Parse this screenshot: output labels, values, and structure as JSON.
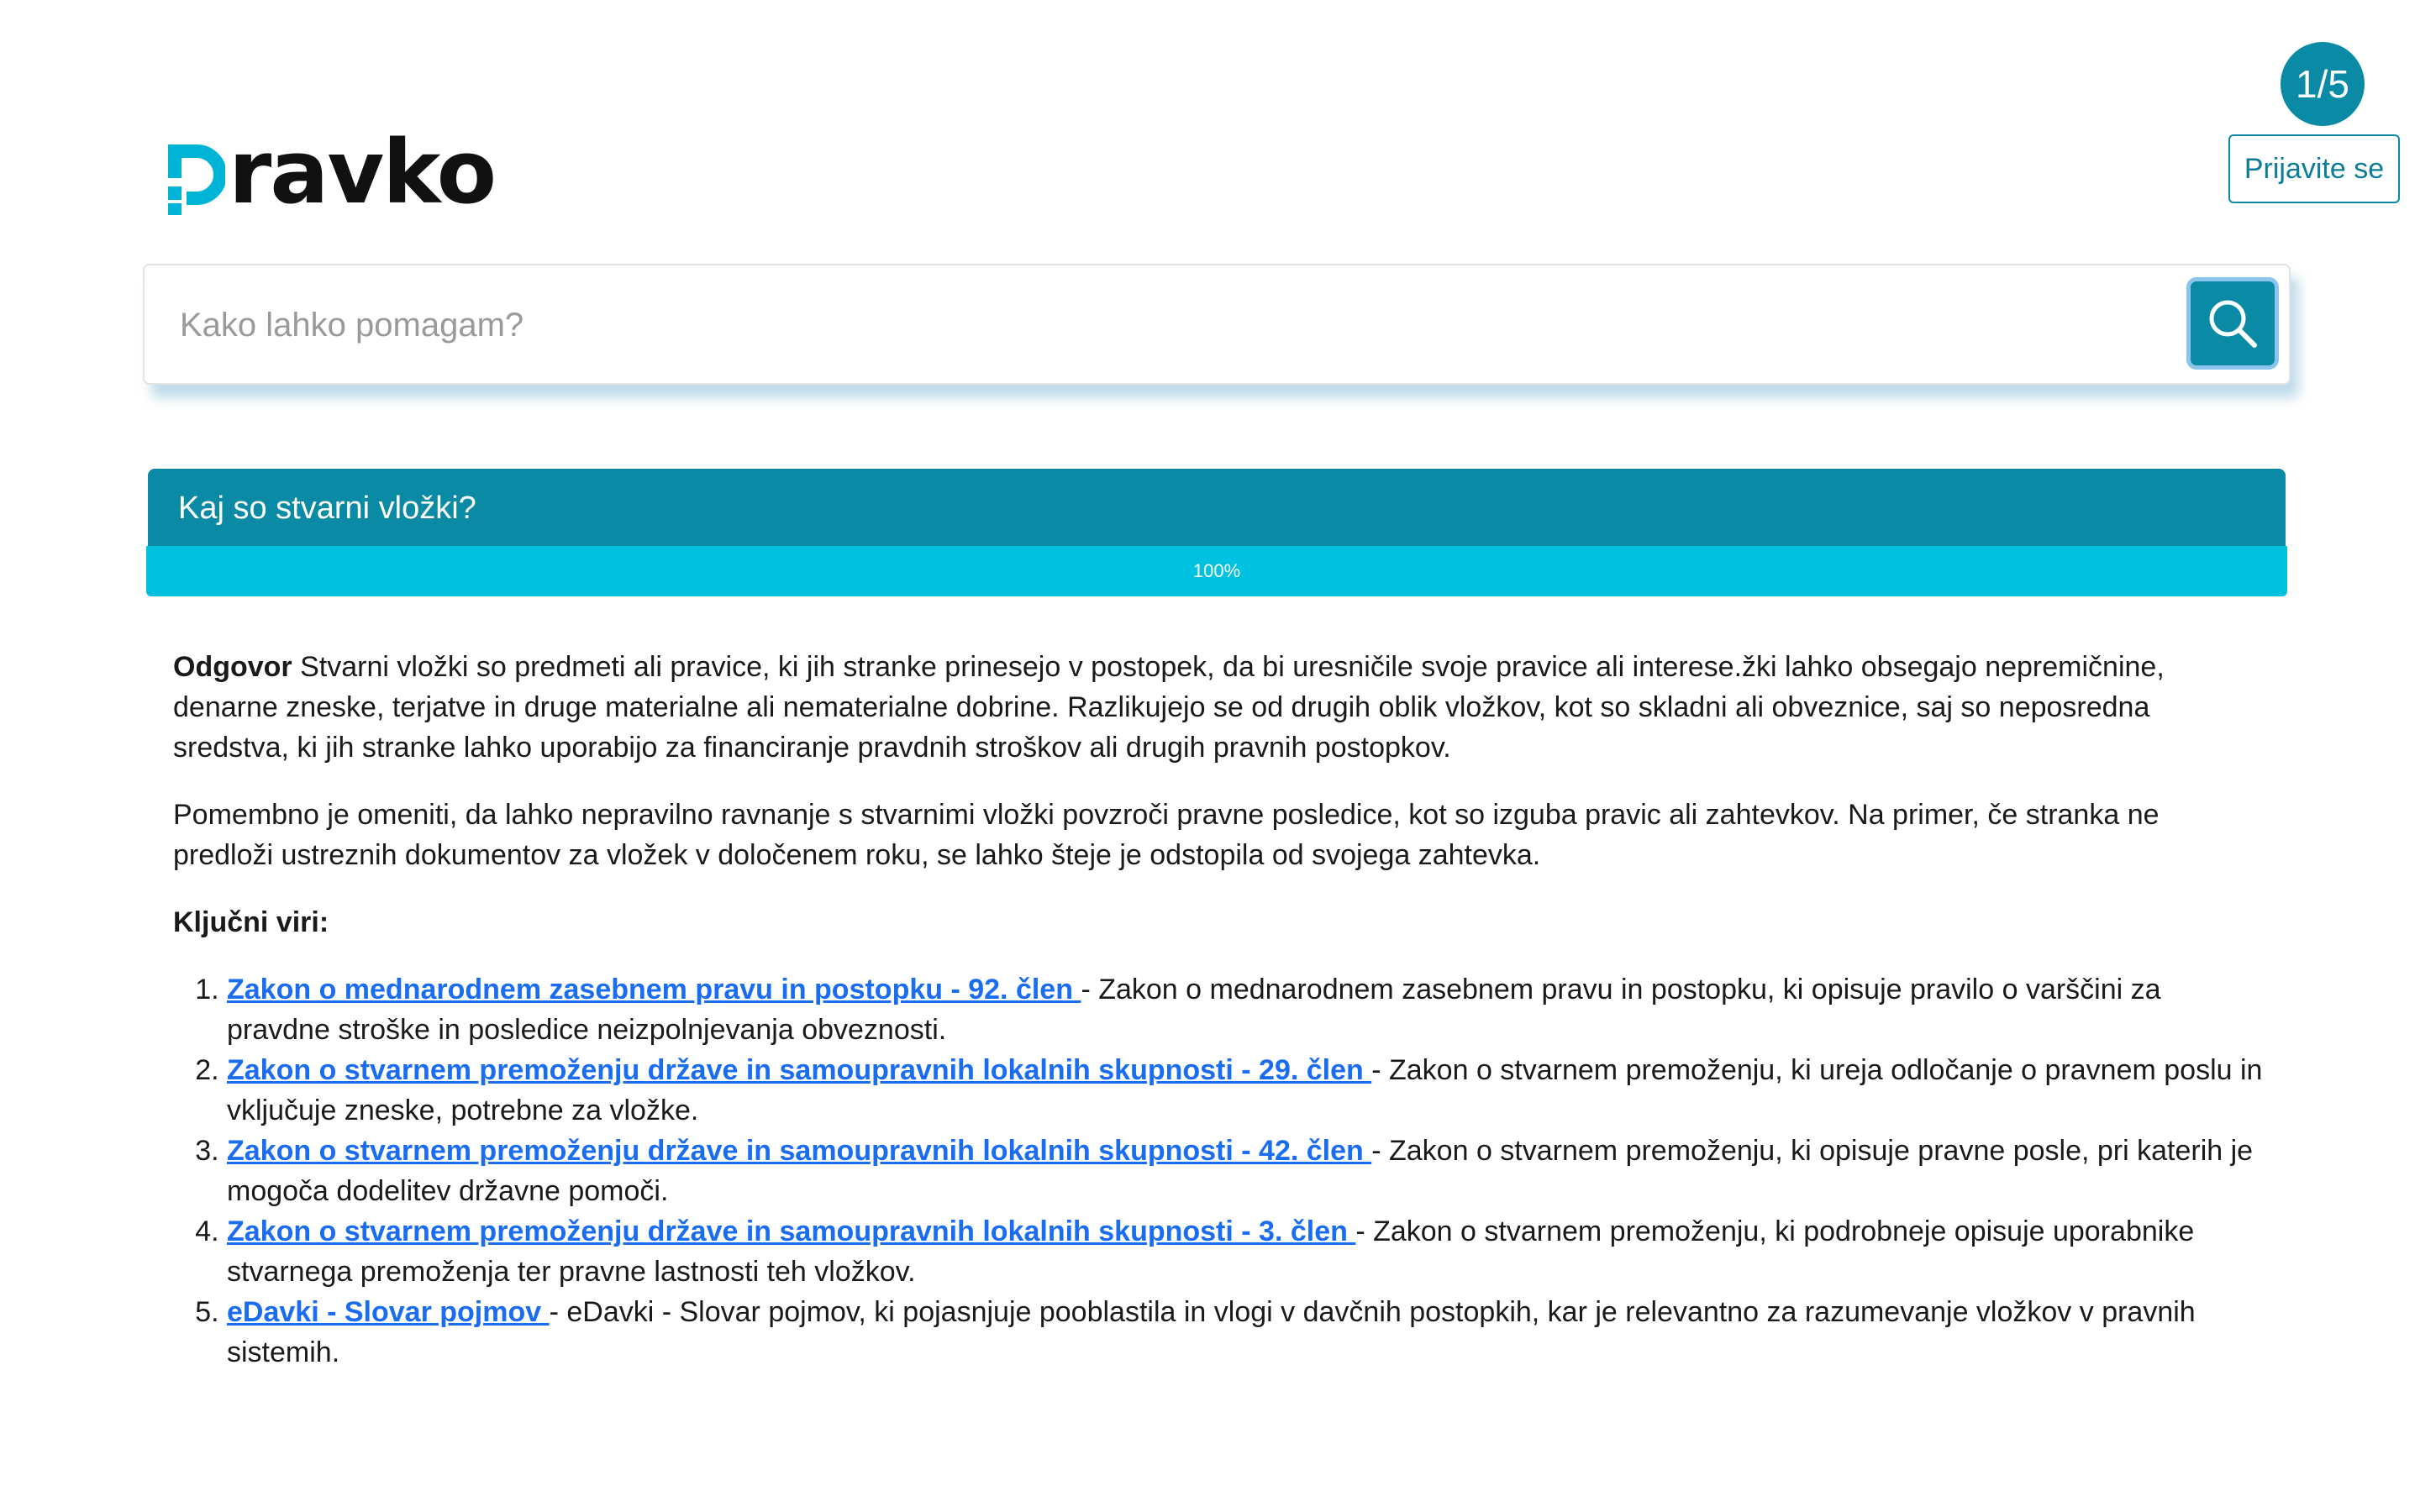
{
  "header": {
    "counter": "1/5",
    "login_label": "Prijavite se",
    "logo_text": "ravko",
    "logo_full": "pravko"
  },
  "search": {
    "placeholder": "Kako lahko pomagam?"
  },
  "question": {
    "title": "Kaj so stvarni vložki?",
    "progress_label": "100%",
    "progress_value": 1.0
  },
  "answer": {
    "lead": "Odgovor",
    "paragraph1": " Stvarni vložki so predmeti ali pravice, ki jih stranke prinesejo v postopek, da bi uresničile svoje pravice ali interese.žki lahko obsegajo nepremičnine, denarne zneske, terjatve in druge materialne ali nematerialne dobrine. Razlikujejo se od drugih oblik vložkov, kot so skladni ali obveznice, saj so neposredna sredstva, ki jih stranke lahko uporabijo za financiranje pravdnih stroškov ali drugih pravnih postopkov.",
    "paragraph2": "Pomembno je omeniti, da lahko nepravilno ravnanje s stvarnimi vložki povzroči pravne posledice, kot so izguba pravic ali zahtevkov. Na primer, če stranka ne predloži ustreznih dokumentov za vložek v določenem roku, se lahko šteje je odstopila od svojega zahtevka.",
    "sources_title": "Ključni viri:",
    "sources": [
      {
        "link": "Zakon o mednarodnem zasebnem pravu in postopku - 92. člen ",
        "desc": " - Zakon o mednarodnem zasebnem pravu in postopku, ki opisuje pravilo o varščini za pravdne stroške in posledice neizpolnjevanja obveznosti."
      },
      {
        "link": "Zakon o stvarnem premoženju države in samoupravnih lokalnih skupnosti - 29. člen ",
        "desc": " - Zakon o stvarnem premoženju, ki ureja odločanje o pravnem poslu in vključuje zneske, potrebne za vložke."
      },
      {
        "link": "Zakon o stvarnem premoženju države in samoupravnih lokalnih skupnosti - 42. člen ",
        "desc": " - Zakon o stvarnem premoženju, ki opisuje pravne posle, pri katerih je mogoča dodelitev državne pomoči."
      },
      {
        "link": "Zakon o stvarnem premoženju države in samoupravnih lokalnih skupnosti - 3. člen ",
        "desc": " - Zakon o stvarnem premoženju, ki podrobneje opisuje uporabnike stvarnega premoženja ter pravne lastnosti teh vložkov."
      },
      {
        "link": "eDavki - Slovar pojmov ",
        "desc": " - eDavki - Slovar pojmov, ki pojasnjuje pooblastila in vlogi v davčnih postopkih, kar je relevantno za razumevanje vložkov v pravnih sistemih."
      }
    ]
  },
  "colors": {
    "brand": "#0b8aa6",
    "progress": "#00c2e0",
    "link": "#1a6cf0",
    "logo_accent": "#00b4d8"
  },
  "icons": {
    "search_button": "search-icon"
  }
}
